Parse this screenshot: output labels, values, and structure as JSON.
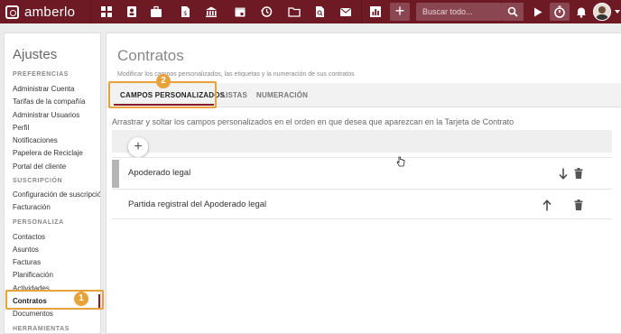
{
  "app": {
    "logo_text": "amberlo"
  },
  "topbar": {
    "icons": [
      "dashboard-icon",
      "contacts-icon",
      "briefcase-icon",
      "documents-icon",
      "bank-icon",
      "calendar-icon",
      "history-icon",
      "folder-icon",
      "document-search-icon",
      "mail-icon",
      "chart-icon"
    ],
    "add_label": "+",
    "search_placeholder": "Buscar todo...",
    "colors": {
      "bar": "#6e1a25",
      "button": "#8a4752"
    }
  },
  "sidebar": {
    "title": "Ajustes",
    "sections": [
      {
        "label": "PREFERENCIAS",
        "items": [
          "Administrar Cuenta",
          "Tarifas de la compañía",
          "Administrar Usuarios",
          "Perfil",
          "Notificaciones",
          "Papelera de Reciclaje",
          "Portal del cliente"
        ]
      },
      {
        "label": "SUSCRIPCIÓN",
        "items": [
          "Configuración de suscripción",
          "Facturación"
        ]
      },
      {
        "label": "PERSONALIZA",
        "items": [
          "Contactos",
          "Asuntos",
          "Facturas",
          "Planificación",
          "Actividades",
          "Contratos",
          "Documentos"
        ]
      },
      {
        "label": "HERRAMIENTAS",
        "items": []
      }
    ],
    "active_item": "Contratos"
  },
  "main": {
    "title": "Contratos",
    "subtitle": "Modificar los campos personalizados, las etiquetas y la numeración de sus contratos",
    "tabs": [
      {
        "label": "CAMPOS PERSONALIZADOS",
        "active": true
      },
      {
        "label": "LISTAS",
        "active": false
      },
      {
        "label": "NUMERACIÓN",
        "active": false
      }
    ],
    "hint": "Arrastrar y soltar los campos personalizados en el orden en que desea que aparezcan en la Tarjeta de Contrato",
    "add_button": "+",
    "fields": [
      {
        "label": "Apoderado legal",
        "move_icon": "arrow-down-icon"
      },
      {
        "label": "Partida registral del Apoderado legal",
        "move_icon": "arrow-up-icon"
      }
    ]
  },
  "annotations": {
    "badge_1": "1",
    "badge_2": "2",
    "color": "#e8a23a"
  }
}
